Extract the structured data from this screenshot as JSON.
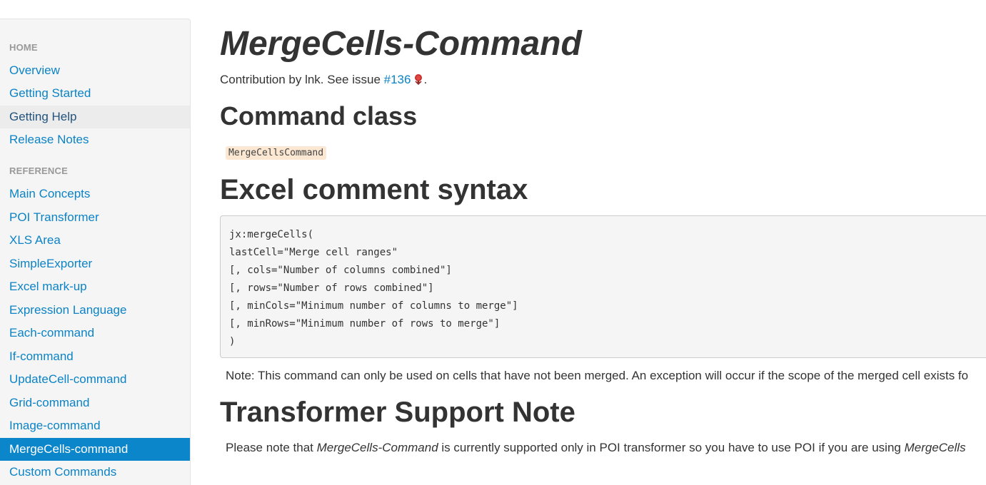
{
  "sidebar": {
    "sections": [
      {
        "header": "HOME",
        "items": [
          {
            "label": "Overview"
          },
          {
            "label": "Getting Started"
          },
          {
            "label": "Getting Help"
          },
          {
            "label": "Release Notes"
          }
        ]
      },
      {
        "header": "REFERENCE",
        "items": [
          {
            "label": "Main Concepts"
          },
          {
            "label": "POI Transformer"
          },
          {
            "label": "XLS Area"
          },
          {
            "label": "SimpleExporter"
          },
          {
            "label": "Excel mark-up"
          },
          {
            "label": "Expression Language"
          },
          {
            "label": "Each-command"
          },
          {
            "label": "If-command"
          },
          {
            "label": "UpdateCell-command"
          },
          {
            "label": "Grid-command"
          },
          {
            "label": "Image-command"
          },
          {
            "label": "MergeCells-command"
          },
          {
            "label": "Custom Commands"
          }
        ]
      }
    ],
    "hovered_item": "Getting Help",
    "active_item": "MergeCells-command"
  },
  "main": {
    "title": "MergeCells-Command",
    "contribution": {
      "prefix": "Contribution by lnk. See issue ",
      "issue_link": "#136",
      "issue_icon": "bug-icon",
      "suffix": "."
    },
    "command_class": {
      "heading": "Command class",
      "class_name": "MergeCellsCommand"
    },
    "syntax": {
      "heading": "Excel comment syntax",
      "code_lines": [
        "jx:mergeCells(",
        "lastCell=\"Merge cell ranges\"",
        "[, cols=\"Number of columns combined\"]",
        "[, rows=\"Number of rows combined\"]",
        "[, minCols=\"Minimum number of columns to merge\"]",
        "[, minRows=\"Minimum number of rows to merge\"]",
        ")"
      ],
      "note": "Note: This command can only be used on cells that have not been merged. An exception will occur if the scope of the merged cell exists fo"
    },
    "transformer_note": {
      "heading": "Transformer Support Note",
      "text_prefix": "Please note that ",
      "text_em1": "MergeCells-Command",
      "text_middle": " is currently supported only in POI transformer so you have to use POI if you are using ",
      "text_em2": "MergeCells"
    }
  },
  "colors": {
    "link": "#0b83c6",
    "active_bg": "#0b86ca",
    "sidebar_bg": "#f5f5f5",
    "inline_code_bg": "#fce8d2",
    "text": "#333333"
  }
}
